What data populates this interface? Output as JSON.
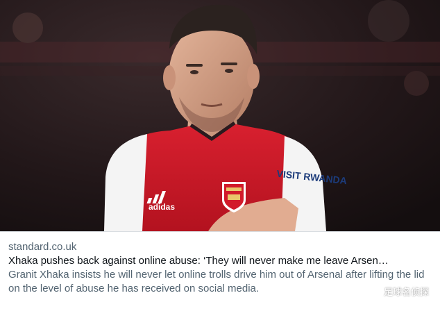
{
  "card": {
    "image_alt": "Granit Xhaka in Arsenal shirt",
    "shirt_sponsor": "VISIT RWANDA",
    "domain": "standard.co.uk",
    "headline": "Xhaka pushes back against online abuse: ‘They will never make me leave Arsen…",
    "description": "Granit Xhaka insists he will never let online trolls drive him out of Arsenal after lifting the lid on the level of abuse he has received on social media."
  },
  "watermark": {
    "text": "足球名侦探",
    "icon": "wechat-icon"
  },
  "colors": {
    "arsenal_red": "#d21a2a",
    "sleeve_white": "#f4f4f4",
    "stadium_dark": "#1c1416",
    "secondary_text": "#536471",
    "primary_text": "#0f1419"
  }
}
